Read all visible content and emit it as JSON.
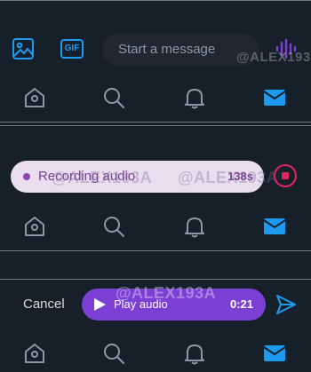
{
  "colors": {
    "background": "#15202b",
    "accent": "#1d9bf0",
    "record_bg": "#e9deef",
    "record_text": "#7a3e98",
    "play_bg": "#7b3fd4",
    "stop": "#e0245e"
  },
  "watermark": "@ALEX193A",
  "panel1": {
    "composer": {
      "placeholder": "Start a message"
    },
    "gif_label": "GIF",
    "icons": [
      "image-icon",
      "gif-icon",
      "voice-waveform-icon"
    ]
  },
  "panel2": {
    "recording": {
      "label": "Recording audio",
      "time": "138s"
    },
    "icons": [
      "recording-dot-icon",
      "stop-icon"
    ]
  },
  "panel3": {
    "cancel_label": "Cancel",
    "player": {
      "label": "Play audio",
      "time": "0:21"
    },
    "icons": [
      "play-icon",
      "send-icon"
    ]
  },
  "nav": {
    "items": [
      "home-icon",
      "search-icon",
      "notifications-icon",
      "messages-icon"
    ],
    "active": "messages-icon"
  }
}
